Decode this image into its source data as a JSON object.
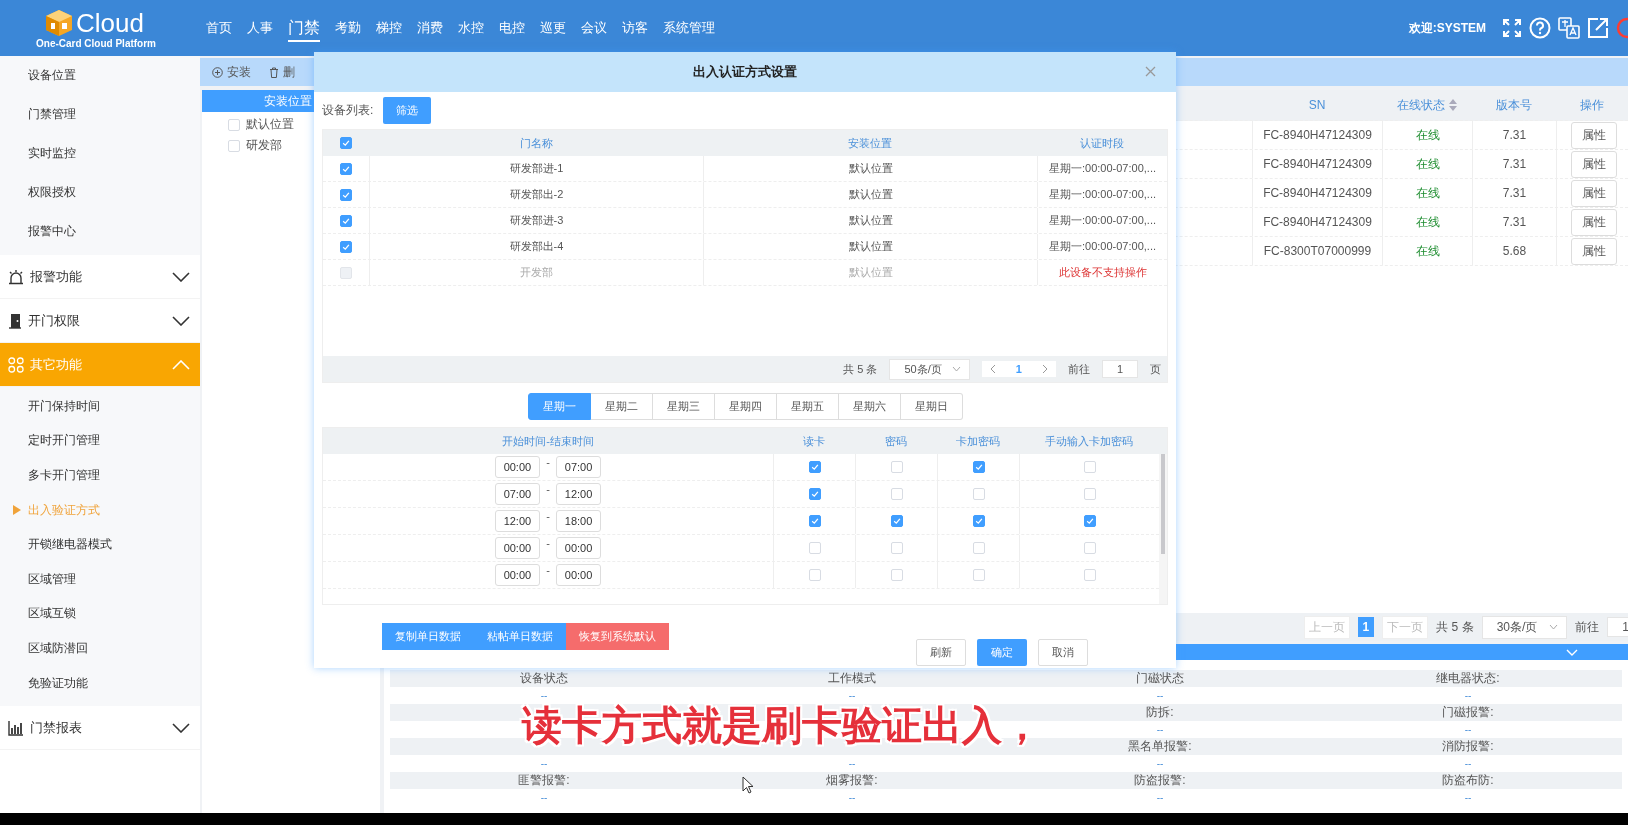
{
  "header": {
    "logo_text": "Cloud",
    "logo_subtitle": "One-Card Cloud Platform",
    "nav": [
      {
        "label": "首页",
        "selected": false
      },
      {
        "label": "人事",
        "selected": false
      },
      {
        "label": "门禁",
        "selected": true
      },
      {
        "label": "考勤",
        "selected": false
      },
      {
        "label": "梯控",
        "selected": false
      },
      {
        "label": "消费",
        "selected": false
      },
      {
        "label": "水控",
        "selected": false
      },
      {
        "label": "电控",
        "selected": false
      },
      {
        "label": "巡更",
        "selected": false
      },
      {
        "label": "会议",
        "selected": false
      },
      {
        "label": "访客",
        "selected": false
      },
      {
        "label": "系统管理",
        "selected": false
      }
    ],
    "welcome": "欢迎:SYSTEM"
  },
  "sidebar": {
    "top_items": [
      "设备位置",
      "门禁管理",
      "实时监控",
      "权限授权",
      "报警中心"
    ],
    "groups": [
      {
        "label": "报警功能",
        "expanded": false
      },
      {
        "label": "开门权限",
        "expanded": false
      },
      {
        "label": "其它功能",
        "expanded": true,
        "children": [
          {
            "label": "开门保持时间",
            "selected": false
          },
          {
            "label": "定时开门管理",
            "selected": false
          },
          {
            "label": "多卡开门管理",
            "selected": false
          },
          {
            "label": "出入验证方式",
            "selected": true
          },
          {
            "label": "开锁继电器模式",
            "selected": false
          },
          {
            "label": "区域管理",
            "selected": false
          },
          {
            "label": "区域互锁",
            "selected": false
          },
          {
            "label": "区域防潜回",
            "selected": false
          },
          {
            "label": "免验证功能",
            "selected": false
          }
        ]
      },
      {
        "label": "门禁报表",
        "expanded": false
      }
    ]
  },
  "toolbar": [
    "安装",
    "删"
  ],
  "location_panel": {
    "title": "安装位置",
    "items": [
      {
        "label": "默认位置",
        "checked": false
      },
      {
        "label": "研发部",
        "checked": false
      }
    ]
  },
  "device_table": {
    "columns": [
      "SN",
      "在线状态",
      "版本号",
      "操作"
    ],
    "rows": [
      {
        "sn": "FC-8940H47124309",
        "status": "在线",
        "version": "7.31",
        "action": "属性"
      },
      {
        "sn": "FC-8940H47124309",
        "status": "在线",
        "version": "7.31",
        "action": "属性"
      },
      {
        "sn": "FC-8940H47124309",
        "status": "在线",
        "version": "7.31",
        "action": "属性"
      },
      {
        "sn": "FC-8940H47124309",
        "status": "在线",
        "version": "7.31",
        "action": "属性"
      },
      {
        "sn": "FC-8300T07000999",
        "status": "在线",
        "version": "5.68",
        "action": "属性"
      }
    ],
    "pagination": {
      "prev": "上一页",
      "page": "1",
      "next": "下一页",
      "total": "共 5 条",
      "page_size": "30条/页",
      "goto": "前往",
      "goto_value": "1"
    }
  },
  "status_rows": [
    {
      "column_1": {
        "label": "设备状态",
        "value": "--"
      },
      "column_2": {
        "label": "工作模式",
        "value": "--"
      },
      "column_3": {
        "label": "门磁状态",
        "value": "--"
      },
      "column_4": {
        "label": "继电器状态:",
        "value": "--"
      }
    },
    {
      "column_3": {
        "label": "防拆:",
        "value": "--"
      },
      "column_4": {
        "label": "门磁报警:",
        "value": "--"
      }
    },
    {
      "column_1": {
        "value": "--"
      },
      "column_2": {
        "value": "--"
      },
      "column_3": {
        "label": "黑名单报警:",
        "value": "--"
      },
      "column_4": {
        "label": "消防报警:",
        "value": "--"
      }
    },
    {
      "column_1": {
        "label": "匪警报警:",
        "value": "--"
      },
      "column_2": {
        "label": "烟雾报警:",
        "value": "--"
      },
      "column_3": {
        "label": "防盗报警:",
        "value": "--"
      },
      "column_4": {
        "label": "防盗布防:",
        "value": "--"
      }
    }
  ],
  "dialog": {
    "title": "出入认证方式设置",
    "device_list_label": "设备列表:",
    "filter_button": "筛选",
    "door_table": {
      "columns": [
        "门名称",
        "安装位置",
        "认证时段"
      ],
      "header_checked": true,
      "rows": [
        {
          "name": "研发部进-1",
          "location": "默认位置",
          "period": "星期一:00:00-07:00,...",
          "checked": true,
          "disabled": false
        },
        {
          "name": "研发部出-2",
          "location": "默认位置",
          "period": "星期一:00:00-07:00,...",
          "checked": true,
          "disabled": false
        },
        {
          "name": "研发部进-3",
          "location": "默认位置",
          "period": "星期一:00:00-07:00,...",
          "checked": true,
          "disabled": false
        },
        {
          "name": "研发部出-4",
          "location": "默认位置",
          "period": "星期一:00:00-07:00,...",
          "checked": true,
          "disabled": false
        },
        {
          "name": "开发部",
          "location": "默认位置",
          "period": "此设备不支持操作",
          "checked": false,
          "disabled": true
        }
      ],
      "pagination": {
        "total": "共 5 条",
        "page_size": "50条/页",
        "page": "1",
        "goto": "前往",
        "goto_value": "1",
        "goto_suffix": "页"
      }
    },
    "day_tabs": [
      {
        "label": "星期一",
        "selected": true
      },
      {
        "label": "星期二",
        "selected": false
      },
      {
        "label": "星期三",
        "selected": false
      },
      {
        "label": "星期四",
        "selected": false
      },
      {
        "label": "星期五",
        "selected": false
      },
      {
        "label": "星期六",
        "selected": false
      },
      {
        "label": "星期日",
        "selected": false
      }
    ],
    "schedule": {
      "columns": [
        "开始时间-结束时间",
        "读卡",
        "密码",
        "卡加密码",
        "手动输入卡加密码"
      ],
      "separator": "-",
      "rows": [
        {
          "start": "00:00",
          "end": "07:00",
          "modes": [
            true,
            false,
            true,
            false
          ]
        },
        {
          "start": "07:00",
          "end": "12:00",
          "modes": [
            true,
            false,
            false,
            false
          ]
        },
        {
          "start": "12:00",
          "end": "18:00",
          "modes": [
            true,
            true,
            true,
            true
          ]
        },
        {
          "start": "00:00",
          "end": "00:00",
          "modes": [
            false,
            false,
            false,
            false
          ]
        },
        {
          "start": "00:00",
          "end": "00:00",
          "modes": [
            false,
            false,
            false,
            false
          ]
        }
      ]
    },
    "action_buttons": [
      {
        "label": "复制单日数据",
        "kind": "primary"
      },
      {
        "label": "粘帖单日数据",
        "kind": "primary"
      },
      {
        "label": "恢复到系统默认",
        "kind": "danger"
      }
    ],
    "footer_buttons": [
      {
        "label": "刷新",
        "kind": "default"
      },
      {
        "label": "确定",
        "kind": "primary"
      },
      {
        "label": "取消",
        "kind": "default"
      }
    ]
  },
  "caption": "读卡方式就是刷卡验证出入，"
}
